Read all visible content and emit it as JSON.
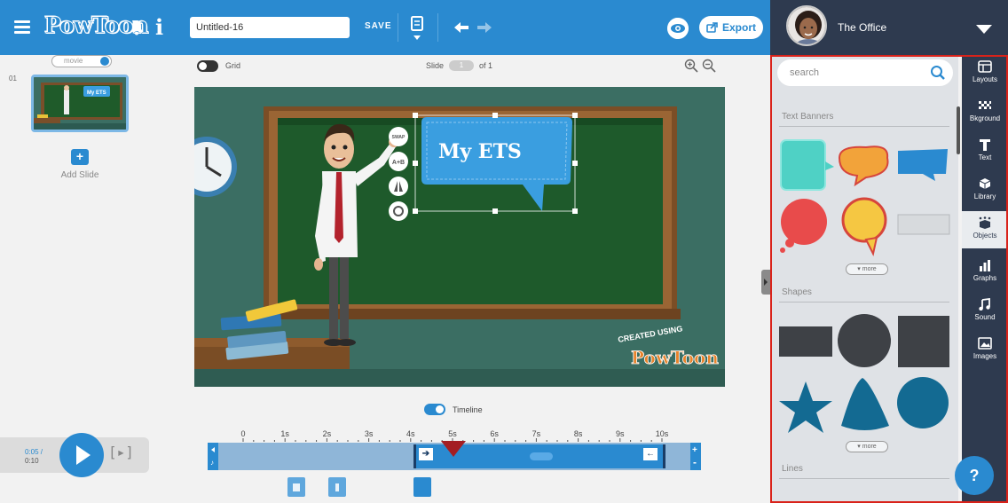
{
  "app": {
    "logo": "PowToon",
    "title_value": "Untitled-16",
    "save_label": "SAVE",
    "export_label": "Export",
    "user_name": "The Office"
  },
  "slides": {
    "movie_label": "movie",
    "items": [
      {
        "number": "01",
        "thumb_text": "My ETS"
      }
    ],
    "add_label": "Add Slide"
  },
  "canvas": {
    "grid_label": "Grid",
    "slide_label": "Slide",
    "slide_current": "1",
    "slide_total": "of 1",
    "speech_text": "My ETS",
    "side_buttons": [
      "SWAP",
      "A+B",
      "",
      ""
    ],
    "watermark_top": "CREATED USING",
    "watermark_logo": "PowToon"
  },
  "timeline": {
    "label": "Timeline",
    "time_current": "0:05 /",
    "time_total": "0:10",
    "ticks": [
      "0",
      "1s",
      "2s",
      "3s",
      "4s",
      "5s",
      "6s",
      "7s",
      "8s",
      "9s",
      "10s"
    ]
  },
  "panel": {
    "search_placeholder": "search",
    "section_text_banners": "Text Banners",
    "section_shapes": "Shapes",
    "section_lines": "Lines",
    "more_label": "more",
    "help_label": "?",
    "tools": [
      {
        "label": "Layouts",
        "icon": "layout-icon"
      },
      {
        "label": "Bkground",
        "icon": "background-icon"
      },
      {
        "label": "Text",
        "icon": "text-icon"
      },
      {
        "label": "Library",
        "icon": "library-icon"
      },
      {
        "label": "Objects",
        "icon": "objects-icon"
      },
      {
        "label": "Graphs",
        "icon": "graph-icon"
      },
      {
        "label": "Sound",
        "icon": "music-note-icon"
      },
      {
        "label": "Images",
        "icon": "image-icon"
      }
    ]
  },
  "colors": {
    "accent": "#2a8ad0",
    "dark_rail": "#2e3a4f",
    "highlight_frame": "#d9221a",
    "playhead": "#a31e23",
    "shape_dark": "#3e4146",
    "shape_teal": "#136a92"
  }
}
